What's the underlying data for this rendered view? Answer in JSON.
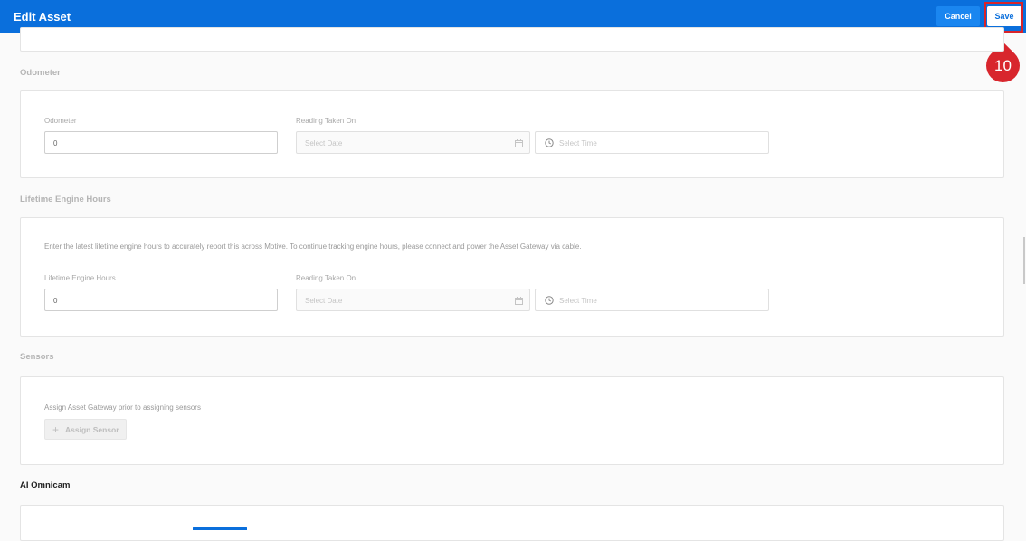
{
  "header": {
    "title": "Edit Asset",
    "cancel_label": "Cancel",
    "save_label": "Save"
  },
  "annotation": {
    "step_number": "10",
    "color": "#d8262d"
  },
  "odometer": {
    "section_title": "Odometer",
    "field_label": "Odometer",
    "field_value": "0",
    "reading_label": "Reading Taken On",
    "date_placeholder": "Select Date",
    "time_placeholder": "Select Time"
  },
  "engine_hours": {
    "section_title": "Lifetime Engine Hours",
    "help_text": "Enter the latest lifetime engine hours to accurately report this across Motive. To continue tracking engine hours, please connect and power the Asset Gateway via cable.",
    "field_label": "Lifetime Engine Hours",
    "field_value": "0",
    "reading_label": "Reading Taken On",
    "date_placeholder": "Select Date",
    "time_placeholder": "Select Time"
  },
  "sensors": {
    "section_title": "Sensors",
    "help_text": "Assign Asset Gateway prior to assigning sensors",
    "assign_label": "Assign Sensor"
  },
  "omnicam": {
    "section_title": "AI Omnicam"
  },
  "colors": {
    "brand_blue": "#0a6fdc",
    "accent_red": "#d8242a"
  },
  "icons": [
    "calendar-icon",
    "clock-icon",
    "plus-icon"
  ]
}
